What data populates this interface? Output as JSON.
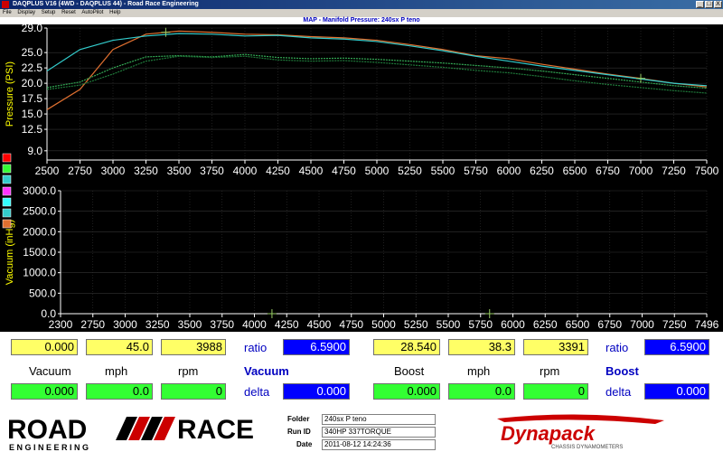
{
  "window": {
    "title": "DAQPLUS V16 (4WD - DAQPLUS 44) - Road Race Engineering",
    "buttons": [
      "_",
      "□",
      "X"
    ]
  },
  "menu": [
    "File",
    "Display",
    "Setup",
    "Reset",
    "AutoPilot",
    "Help"
  ],
  "chart_title": "MAP - Manifold Pressure: 240sx P teno",
  "colors": {
    "background": "#000000",
    "axis": "#ffffff",
    "axis_label": "#ffff00",
    "series_orange": "#e07030",
    "series_cyan": "#33cccc",
    "series_green": "#33aa55",
    "series_red": "#cc3333"
  },
  "chart_data": [
    {
      "type": "line",
      "ylabel": "Pressure (PSI)",
      "xlabel": "",
      "xlim": [
        2500,
        7500
      ],
      "ylim": [
        7.5,
        29.0
      ],
      "x_ticks": [
        "2500",
        "2750",
        "3000",
        "3250",
        "3500",
        "3750",
        "4000",
        "4250",
        "4500",
        "4750",
        "5000",
        "5250",
        "5500",
        "5750",
        "6000",
        "6250",
        "6500",
        "6750",
        "7000",
        "7250",
        "7500"
      ],
      "y_ticks": [
        "9.0",
        "12.5",
        "15.0",
        "17.5",
        "20.0",
        "22.5",
        "25.0",
        "29.0"
      ],
      "grid": true,
      "series": [
        {
          "color": "#e07030",
          "x": [
            2500,
            2750,
            3000,
            3250,
            3500,
            3750,
            4000,
            4250,
            4500,
            4750,
            5000,
            5250,
            5500,
            5750,
            6000,
            6250,
            6500,
            6750,
            7000,
            7250,
            7500
          ],
          "y": [
            15.7,
            19.0,
            25.5,
            28.0,
            28.5,
            28.3,
            28.0,
            27.9,
            27.6,
            27.4,
            27.0,
            26.3,
            25.5,
            24.5,
            24.0,
            23.1,
            22.3,
            21.5,
            20.8,
            20.0,
            19.4
          ]
        },
        {
          "color": "#33cccc",
          "x": [
            2500,
            2750,
            3000,
            3250,
            3500,
            3750,
            4000,
            4250,
            4500,
            4750,
            5000,
            5250,
            5500,
            5750,
            6000,
            6250,
            6500,
            6750,
            7000,
            7250,
            7500
          ],
          "y": [
            22.0,
            25.5,
            27.0,
            27.7,
            28.1,
            28.0,
            27.7,
            27.8,
            27.4,
            27.2,
            26.8,
            26.1,
            25.3,
            24.4,
            23.6,
            22.8,
            22.1,
            21.4,
            20.7,
            20.0,
            19.6
          ]
        },
        {
          "color": "#33aa55",
          "x": [
            2500,
            2750,
            3000,
            3250,
            3500,
            3750,
            4000,
            4250,
            4500,
            4750,
            5000,
            5250,
            5500,
            5750,
            6000,
            6250,
            6500,
            6750,
            7000,
            7250,
            7500
          ],
          "y": [
            19.3,
            20.2,
            22.5,
            24.3,
            24.5,
            24.3,
            24.7,
            24.2,
            24.0,
            24.1,
            23.9,
            23.6,
            23.3,
            22.9,
            22.5,
            22.0,
            21.4,
            20.8,
            20.2,
            19.6,
            19.2
          ]
        },
        {
          "color": "#1f7a3a",
          "x": [
            2500,
            2750,
            3000,
            3250,
            3500,
            3750,
            4000,
            4250,
            4500,
            4750,
            5000,
            5250,
            5500,
            5750,
            6000,
            6250,
            6500,
            6750,
            7000,
            7250,
            7500
          ],
          "y": [
            19.0,
            19.7,
            21.5,
            23.6,
            24.4,
            24.2,
            24.4,
            23.8,
            23.6,
            23.7,
            23.4,
            23.0,
            22.6,
            22.1,
            21.7,
            21.1,
            20.4,
            19.8,
            19.3,
            18.8,
            18.4
          ]
        }
      ],
      "markers": [
        {
          "x": 3400,
          "y": 28.3
        },
        {
          "x": 7000,
          "y": 20.8
        }
      ]
    },
    {
      "type": "line",
      "ylabel": "Vacuum (inHg)",
      "xlabel": "",
      "xlim": [
        2300,
        7496
      ],
      "ylim": [
        0,
        3000
      ],
      "x_ticks": [
        "2300",
        "2750",
        "3000",
        "3250",
        "3500",
        "3750",
        "4000",
        "4250",
        "4500",
        "4750",
        "5000",
        "5250",
        "5500",
        "5750",
        "6000",
        "6250",
        "6500",
        "6750",
        "7000",
        "7250",
        "7496"
      ],
      "y_ticks": [
        "0.0",
        "500.0",
        "1000.0",
        "1500.0",
        "2000.0",
        "2500.0",
        "3000.0"
      ],
      "grid": true,
      "series": [],
      "markers": [
        {
          "x": 4000,
          "y": 0
        },
        {
          "x": 5750,
          "y": 0
        }
      ]
    }
  ],
  "legend_swatches_top": [
    "#ff0000",
    "#33ff33",
    "#33cccc"
  ],
  "legend_swatches_bottom": [
    "#ff33ff",
    "#33ffff",
    "#33cccc",
    "#e07030"
  ],
  "readout": {
    "left": {
      "vals": [
        "0.000",
        "45.0",
        "3988"
      ],
      "labels": [
        "Vacuum",
        "mph",
        "rpm"
      ],
      "deltas": [
        "0.000",
        "0.0",
        "0"
      ],
      "ratio_label": "ratio",
      "ratio_value": "6.5900",
      "section": "Vacuum",
      "delta_label": "delta",
      "delta_value": "0.000"
    },
    "right": {
      "vals": [
        "28.540",
        "38.3",
        "3391"
      ],
      "labels": [
        "Boost",
        "mph",
        "rpm"
      ],
      "deltas": [
        "0.000",
        "0.0",
        "0"
      ],
      "ratio_label": "ratio",
      "ratio_value": "6.5900",
      "section": "Boost",
      "delta_label": "delta",
      "delta_value": "0.000"
    }
  },
  "footer": {
    "logo_road": "ROAD",
    "logo_race": "RACE",
    "logo_sub": "E N G I N E E R I N G",
    "folder_label": "Folder",
    "folder_value": "240sx P teno",
    "runid_label": "Run ID",
    "runid_value": "340HP 337TORQUE",
    "date_label": "Date",
    "date_value": "2011-08-12 14:24:36",
    "brand": "Dynapack",
    "brand_sub": "CHASSIS DYNAMOMETERS"
  }
}
